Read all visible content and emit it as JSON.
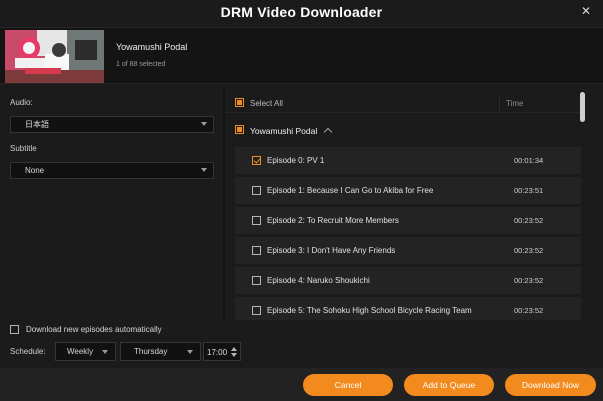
{
  "window": {
    "title": "DRM Video Downloader",
    "close_glyph": "✕"
  },
  "header": {
    "show_title": "Yowamushi Podal",
    "selection_count": "1 of 88 selected"
  },
  "left": {
    "audio_label": "Audio:",
    "audio_value": "日本語",
    "subtitle_label": "Subtitle",
    "subtitle_value": "None"
  },
  "list": {
    "select_all_label": "Select All",
    "time_header": "Time",
    "group_label": "Yowamushi Podal",
    "episodes": [
      {
        "label": "Episode 0: PV 1",
        "time": "00:01:34",
        "checked": true
      },
      {
        "label": "Episode 1: Because I Can Go to Akiba for Free",
        "time": "00:23:51",
        "checked": false
      },
      {
        "label": "Episode 2: To Recruit More Members",
        "time": "00:23:52",
        "checked": false
      },
      {
        "label": "Episode 3: I Don't Have Any Friends",
        "time": "00:23:52",
        "checked": false
      },
      {
        "label": "Episode 4: Naruko Shoukichi",
        "time": "00:23:52",
        "checked": false
      },
      {
        "label": "Episode 5: The Sohoku High School Bicycle Racing Team",
        "time": "00:23:52",
        "checked": false
      }
    ]
  },
  "schedule": {
    "auto_label": "Download new episodes automatically",
    "label": "Schedule:",
    "frequency": "Weekly",
    "day": "Thursday",
    "time": "17:00"
  },
  "buttons": {
    "cancel": "Cancel",
    "add_to_queue": "Add to Queue",
    "download_now": "Download Now"
  },
  "colors": {
    "accent": "#f28a1e",
    "background": "#1b1b1b",
    "row": "#232323"
  }
}
